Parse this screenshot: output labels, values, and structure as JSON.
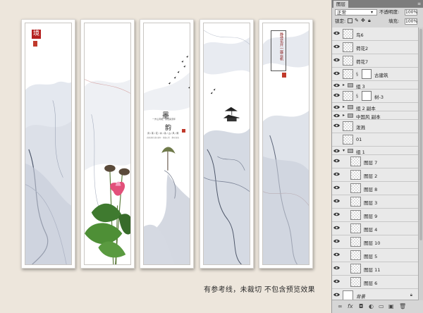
{
  "canvas": {
    "panel1_title_char": "境",
    "panel3_title1": "墨",
    "panel3_title2": "韵",
    "panel3_subtitle": "一岁山河地，墨色染流年",
    "panel3_line": "诗 / 茶 / 花 / 水 / 墨 / 山 / 风 / 雨",
    "panel3_small": "光影流转 清水流年 · 意由心生 · 静水深流",
    "panel5_vertical": "静待花开一展云帆",
    "caption": "有参考线，未裁切 不包含预览效果"
  },
  "layers_panel": {
    "tab_label": "图层",
    "blend_mode": "正常",
    "opacity_label": "不透明度:",
    "opacity_value": "100%",
    "lock_label": "锁定:",
    "fill_label": "填充:",
    "fill_value": "100%",
    "layers": [
      {
        "name": "鸟6",
        "type": "layer"
      },
      {
        "name": "荷花2",
        "type": "layer"
      },
      {
        "name": "荷花7",
        "type": "layer"
      },
      {
        "name": "古建筑",
        "type": "masked"
      },
      {
        "name": "组 3",
        "type": "folder"
      },
      {
        "name": "树-3",
        "type": "masked"
      },
      {
        "name": "组 2 副本",
        "type": "folder"
      },
      {
        "name": "中国风 副本",
        "type": "folder"
      },
      {
        "name": "泼溅",
        "type": "layer"
      },
      {
        "name": "01",
        "type": "layer"
      },
      {
        "name": "组 1",
        "type": "folder-open"
      },
      {
        "name": "图层 7",
        "type": "child"
      },
      {
        "name": "图层 2",
        "type": "child"
      },
      {
        "name": "图层 8",
        "type": "child"
      },
      {
        "name": "图层 3",
        "type": "child"
      },
      {
        "name": "图层 9",
        "type": "child"
      },
      {
        "name": "图层 4",
        "type": "child"
      },
      {
        "name": "图层 10",
        "type": "child"
      },
      {
        "name": "图层 5",
        "type": "child"
      },
      {
        "name": "图层 11",
        "type": "child"
      },
      {
        "name": "图层 6",
        "type": "child"
      },
      {
        "name": "背景",
        "type": "background"
      }
    ]
  }
}
